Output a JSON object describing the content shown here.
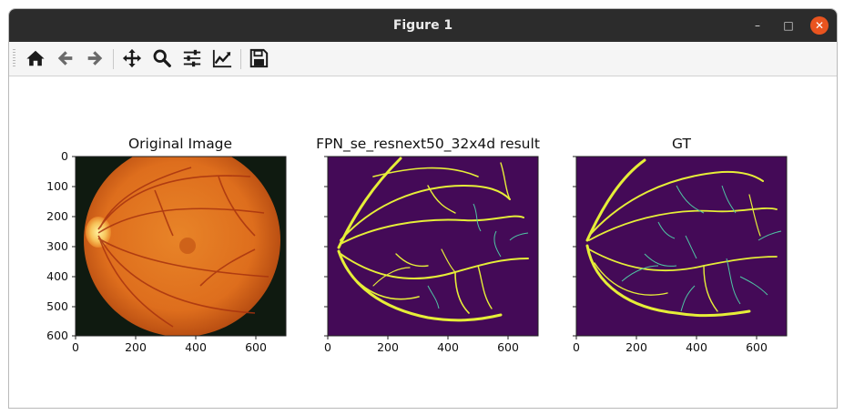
{
  "window": {
    "title": "Figure 1",
    "controls": {
      "minimize": "–",
      "maximize": "□",
      "close": "✕"
    }
  },
  "toolbar": {
    "buttons": [
      {
        "name": "home",
        "icon": "home-icon"
      },
      {
        "name": "back",
        "icon": "arrow-left-icon"
      },
      {
        "name": "forward",
        "icon": "arrow-right-icon"
      },
      {
        "name": "pan",
        "icon": "move-icon"
      },
      {
        "name": "zoom",
        "icon": "magnifier-icon"
      },
      {
        "name": "subplots",
        "icon": "sliders-icon"
      },
      {
        "name": "customize",
        "icon": "line-chart-icon"
      },
      {
        "name": "save",
        "icon": "floppy-icon"
      }
    ]
  },
  "figure": {
    "colors": {
      "vessel": "#e8ee3a",
      "vessel_faint": "#4fc5a4",
      "background": "#440a57",
      "fundus": "#e57a22"
    },
    "panels": [
      {
        "title": "Original Image",
        "image": "retina fundus photograph"
      },
      {
        "title": "FPN_se_resnext50_32x4d result",
        "image": "segmentation mask"
      },
      {
        "title": "GT",
        "image": "ground truth mask"
      }
    ]
  },
  "chart_data": [
    {
      "type": "image",
      "title": "Original Image",
      "xlim": [
        0,
        700
      ],
      "ylim": [
        600,
        0
      ],
      "xticks": [
        "0",
        "200",
        "400",
        "600"
      ],
      "yticks": [
        "0",
        "100",
        "200",
        "300",
        "400",
        "500",
        "600"
      ]
    },
    {
      "type": "image",
      "title": "FPN_se_resnext50_32x4d result",
      "xlim": [
        0,
        700
      ],
      "ylim": [
        600,
        0
      ],
      "xticks": [
        "0",
        "200",
        "400",
        "600"
      ],
      "yticks": []
    },
    {
      "type": "image",
      "title": "GT",
      "xlim": [
        0,
        700
      ],
      "ylim": [
        600,
        0
      ],
      "xticks": [
        "0",
        "200",
        "400",
        "600"
      ],
      "yticks": []
    }
  ]
}
